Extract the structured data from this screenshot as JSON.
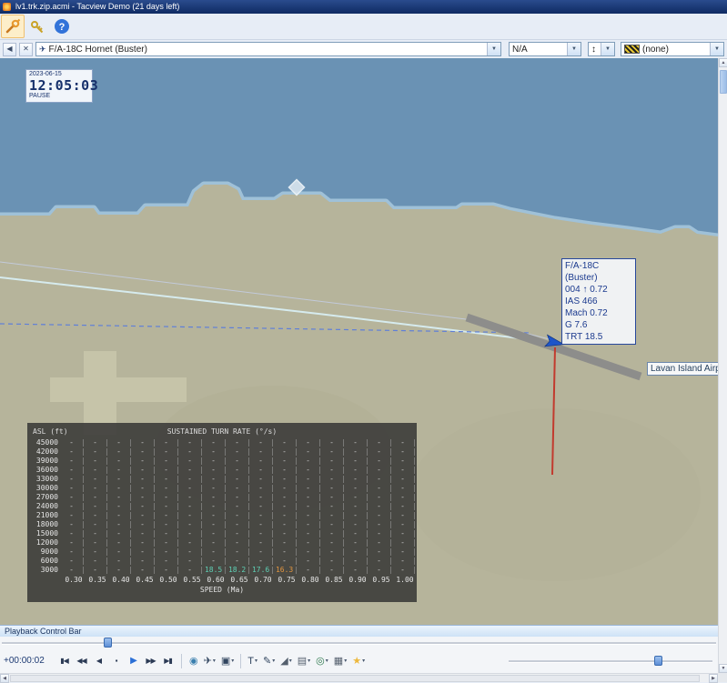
{
  "window": {
    "title": "lv1.trk.zip.acmi - Tacview Demo (21 days left)"
  },
  "toolbar": {
    "help_glyph": "?"
  },
  "selection_bar": {
    "primary_object": "F/A-18C Hornet (Buster)",
    "secondary_object": "N/A",
    "telemetry": "(none)",
    "dock_glyph": "◀",
    "close_glyph": "✕",
    "mini_glyph": "↕"
  },
  "map": {
    "clock": {
      "date": "2023-06-15",
      "time": "12:05:03",
      "status": "PAUSE"
    },
    "target_label": {
      "title": "F/A-18C (Buster)",
      "lines": [
        "004 ↑ 0.72",
        "IAS 466",
        "Mach 0.72",
        "G 7.6",
        "TRT 18.5"
      ]
    },
    "airport_label": "Lavan Island Airport"
  },
  "chart_data": {
    "type": "table",
    "title": "SUSTAINED TURN RATE (°/s)",
    "ylabel": "ASL (ft)",
    "xlabel": "SPEED (Ma)",
    "speeds": [
      "0.30",
      "0.35",
      "0.40",
      "0.45",
      "0.50",
      "0.55",
      "0.60",
      "0.65",
      "0.70",
      "0.75",
      "0.80",
      "0.85",
      "0.90",
      "0.95",
      "1.00"
    ],
    "altitudes": [
      "45000",
      "42000",
      "39000",
      "36000",
      "33000",
      "30000",
      "27000",
      "24000",
      "21000",
      "18000",
      "15000",
      "12000",
      "9000",
      "6000",
      "3000"
    ],
    "empty_cell": "-",
    "values": [
      {
        "alt": "3000",
        "speed": "0.60",
        "value": "18.5",
        "state": "normal"
      },
      {
        "alt": "3000",
        "speed": "0.65",
        "value": "18.2",
        "state": "normal"
      },
      {
        "alt": "3000",
        "speed": "0.70",
        "value": "17.6",
        "state": "normal"
      },
      {
        "alt": "3000",
        "speed": "0.75",
        "value": "16.3",
        "state": "current"
      }
    ],
    "value_color": "#5ECFB4",
    "current_value_color": "#E2953F"
  },
  "playback": {
    "header": "Playback Control Bar",
    "time": "+00:00:02",
    "transport": [
      {
        "name": "skip-to-start",
        "glyph": "▮◀"
      },
      {
        "name": "fast-rewind",
        "glyph": "◀◀"
      },
      {
        "name": "play-backward",
        "glyph": "◀"
      },
      {
        "name": "stop",
        "glyph": "▪"
      },
      {
        "name": "play",
        "glyph": "▶",
        "accent": true
      },
      {
        "name": "fast-forward",
        "glyph": "▶▶"
      },
      {
        "name": "skip-to-end",
        "glyph": "▶▮"
      }
    ],
    "tools": [
      {
        "name": "world-view",
        "glyph": "◉",
        "color": "#3a7fae",
        "dropdown": false
      },
      {
        "name": "aircraft-view",
        "glyph": "✈",
        "color": "#30445e",
        "dropdown": true
      },
      {
        "name": "camera-view",
        "glyph": "▣",
        "color": "#30445e",
        "dropdown": true
      },
      {
        "divider": true
      },
      {
        "name": "text-tool",
        "glyph": "T",
        "color": "#30445e",
        "dropdown": true
      },
      {
        "name": "pencil-tool",
        "glyph": "✎",
        "color": "#30445e",
        "dropdown": true
      },
      {
        "name": "shapes-tool",
        "glyph": "◢",
        "color": "#55606e",
        "dropdown": true
      },
      {
        "name": "layers-tool",
        "glyph": "▤",
        "color": "#55606e",
        "dropdown": true
      },
      {
        "name": "telemetry-tool",
        "glyph": "◎",
        "color": "#2f7a4e",
        "dropdown": true
      },
      {
        "name": "grid-tool",
        "glyph": "▦",
        "color": "#55606e",
        "dropdown": true
      },
      {
        "name": "favorites",
        "glyph": "★",
        "color": "#edb83d",
        "dropdown": true
      }
    ]
  },
  "colors": {
    "water": "#6A92B4",
    "land": "#B6B49B",
    "shallow_fringe": "#9FC1D8",
    "trail": "#D8EEF2",
    "predicted_path": "#5F7FD8",
    "runway": "#8D8D8B",
    "altitude_line": "#C23A2E",
    "aircraft": "#1E55C8",
    "accent_blue": "#2A6FD6"
  }
}
